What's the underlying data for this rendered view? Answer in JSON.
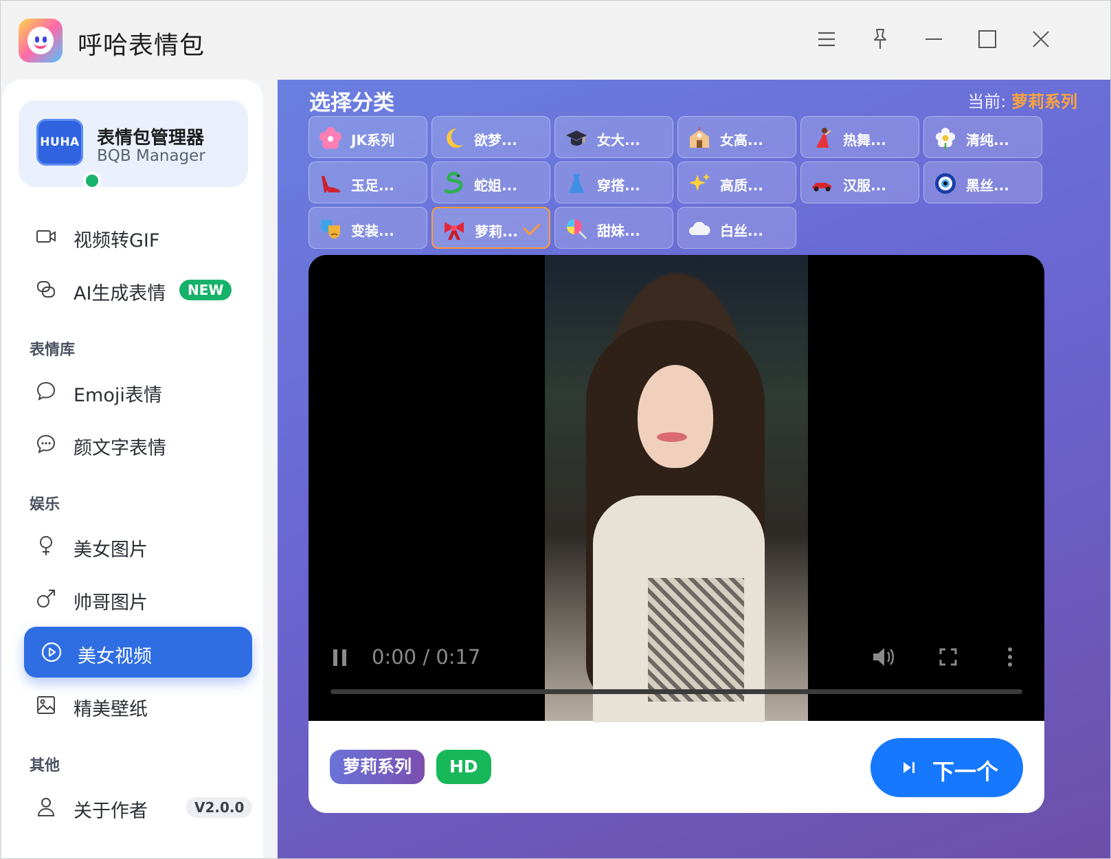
{
  "window": {
    "title": "呼哈表情包",
    "controls": [
      "menu-icon",
      "pin-icon",
      "minimize-icon",
      "maximize-icon",
      "close-icon"
    ]
  },
  "sidebar": {
    "brand": {
      "badge_text": "HUHA",
      "name": "表情包管理器",
      "subtitle": "BQB Manager",
      "status_color": "#18b26b"
    },
    "items_top": [
      {
        "label": "视频转GIF",
        "icon": "video-camera-icon"
      },
      {
        "label": "AI生成表情",
        "icon": "ai-chat-icon",
        "badge": "NEW"
      }
    ],
    "section_emoji": "表情库",
    "items_emoji": [
      {
        "label": "Emoji表情",
        "icon": "chat-bubble-icon"
      },
      {
        "label": "颜文字表情",
        "icon": "chat-dots-icon"
      }
    ],
    "section_fun": "娱乐",
    "items_fun": [
      {
        "label": "美女图片",
        "icon": "female-icon"
      },
      {
        "label": "帅哥图片",
        "icon": "male-icon"
      },
      {
        "label": "美女视频",
        "icon": "play-circle-icon",
        "active": true
      },
      {
        "label": "精美壁纸",
        "icon": "image-icon"
      }
    ],
    "section_other": "其他",
    "items_other": [
      {
        "label": "关于作者",
        "icon": "user-icon",
        "badge": "V2.0.0"
      }
    ],
    "accent_color": "#2f6de3"
  },
  "main": {
    "category_title": "选择分类",
    "current_prefix": "当前:",
    "current_value": "萝莉系列",
    "categories": [
      {
        "label": "JK系列",
        "icon": "cherry-blossom"
      },
      {
        "label": "欲梦...",
        "icon": "crescent-moon"
      },
      {
        "label": "女大...",
        "icon": "graduation-cap"
      },
      {
        "label": "女高...",
        "icon": "school"
      },
      {
        "label": "热舞...",
        "icon": "dancer"
      },
      {
        "label": "清纯...",
        "icon": "flower"
      },
      {
        "label": "玉足...",
        "icon": "high-heel"
      },
      {
        "label": "蛇姐...",
        "icon": "snake"
      },
      {
        "label": "穿搭...",
        "icon": "dress"
      },
      {
        "label": "高质...",
        "icon": "sparkles"
      },
      {
        "label": "汉服...",
        "icon": "race-car"
      },
      {
        "label": "黑丝...",
        "icon": "nazar-amulet"
      },
      {
        "label": "变装...",
        "icon": "theater-masks"
      },
      {
        "label": "萝莉...",
        "icon": "ribbon",
        "selected": true
      },
      {
        "label": "甜妹...",
        "icon": "lollipop"
      },
      {
        "label": "白丝...",
        "icon": "cloud"
      }
    ],
    "player": {
      "time": "0:00 / 0:17",
      "progress": 0.0,
      "tags": [
        "萝莉系列",
        "HD"
      ],
      "next_label": "下一个"
    },
    "accent_orange": "#ffa53a"
  }
}
